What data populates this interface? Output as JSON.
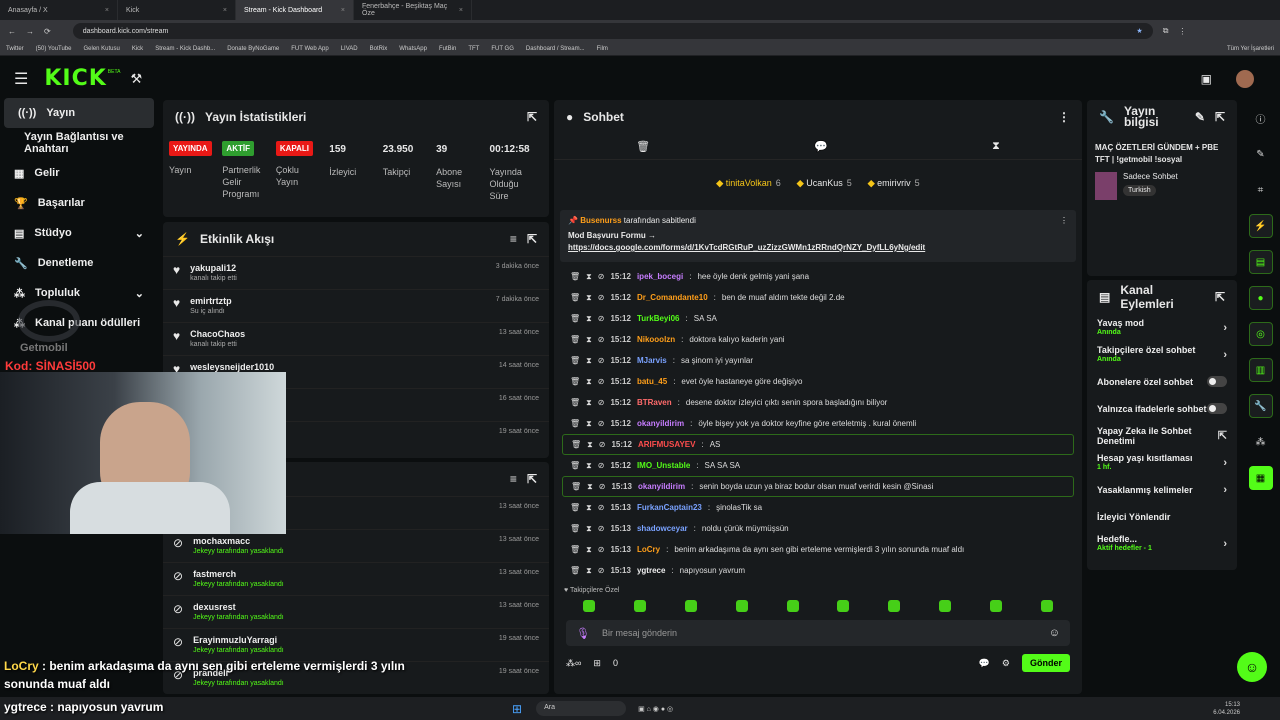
{
  "tabs": [
    "Anasayfa / X",
    "Kick",
    "Stream - Kick Dashboard",
    "Fenerbahçe - Beşiktaş Maç Öze"
  ],
  "url": "dashboard.kick.com/stream",
  "bookmarks": [
    "Twitter",
    "(50) YouTube",
    "Gelen Kutusu",
    "Kick",
    "Stream - Kick Dashb...",
    "Donate ByNoGame",
    "FUT Web App",
    "LIVAD",
    "BotRix",
    "WhatsApp",
    "FutBin",
    "TFT",
    "FUT GG",
    "Dashboard / Stream...",
    "Film"
  ],
  "bookmarks_right": "Tüm Yer İşaretleri",
  "logo": "KICK",
  "logo_beta": "BETA",
  "sidebar": [
    "Yayın",
    "Yayın Bağlantısı ve Anahtarı",
    "Gelir",
    "Başarılar",
    "Stüdyo",
    "Denetleme",
    "Topluluk",
    "Kanal puanı ödülleri"
  ],
  "stats": {
    "title": "Yayın İstatistikleri",
    "items": [
      {
        "badge": "YAYINDA",
        "color": "#e91916",
        "label": "Yayın"
      },
      {
        "badge": "AKTİF",
        "color": "#2f9e2f",
        "label": "Partnerlik Gelir Programı"
      },
      {
        "badge": "KAPALI",
        "color": "#e91916",
        "label": "Çoklu Yayın"
      },
      {
        "value": "159",
        "label": "İzleyici"
      },
      {
        "value": "23.950",
        "label": "Takipçi"
      },
      {
        "value": "39",
        "label": "Abone Sayısı"
      },
      {
        "value": "00:12:58",
        "label": "Yayında Olduğu Süre"
      }
    ]
  },
  "activity": {
    "title": "Etkinlik Akışı",
    "rows": [
      {
        "name": "yakupali12",
        "sub": "kanalı takip etti",
        "time": "3 dakika önce"
      },
      {
        "name": "emirtrtztp",
        "sub": "Su iç alındı",
        "time": "7 dakika önce"
      },
      {
        "name": "ChacoChaos",
        "sub": "kanalı takip etti",
        "time": "13 saat önce"
      },
      {
        "name": "wesleysneijder1010",
        "sub": "",
        "time": "14 saat önce"
      },
      {
        "name": "",
        "sub": "",
        "time": "16 saat önce"
      },
      {
        "name": "",
        "sub": "",
        "time": "19 saat önce"
      }
    ]
  },
  "mod": {
    "title": "Yasaklı Kullanıcılar",
    "rows": [
      {
        "name": "",
        "sub": "",
        "time": "13 saat önce"
      },
      {
        "name": "mochaxmacc",
        "sub": "Jekeyy tarafından yasaklandı",
        "time": "13 saat önce"
      },
      {
        "name": "fastmerch",
        "sub": "Jekeyy tarafından yasaklandı",
        "time": "13 saat önce"
      },
      {
        "name": "dexusrest",
        "sub": "Jekeyy tarafından yasaklandı",
        "time": "13 saat önce"
      },
      {
        "name": "ErayinmuzluYarragi",
        "sub": "Jekeyy tarafından yasaklandı",
        "time": "19 saat önce"
      },
      {
        "name": "prandeli",
        "sub": "Jekeyy tarafından yasaklandı",
        "time": "19 saat önce"
      }
    ]
  },
  "chat": {
    "title": "Sohbet",
    "top": [
      {
        "rank": "1",
        "name": "tinitaVolkan",
        "n": "6"
      },
      {
        "name": "UcanKus",
        "n": "5"
      },
      {
        "name": "emirivriv",
        "n": "5"
      }
    ],
    "pin_by": "Busenurss",
    "pin_text": "tarafından sabitlendi",
    "pin_title": "Mod Başvuru Formu →",
    "pin_link": "https://docs.google.com/forms/d/1KvTcdRGtRuP_uzZizzGWMn1zRRndQrNZY_DyfLL6yNg/edit",
    "messages": [
      {
        "t": "15:12",
        "u": "ipek_bocegi",
        "c": "#c77dff",
        "m": "hee öyle denk gelmiş yani şana"
      },
      {
        "t": "15:12",
        "u": "Dr_Comandante10",
        "c": "#ff9f1a",
        "m": "ben de muaf aldım tekte değil 2.de"
      },
      {
        "t": "15:12",
        "u": "TurkBeyi06",
        "c": "#53fc18",
        "m": "SA SA"
      },
      {
        "t": "15:12",
        "u": "Nikooolzn",
        "c": "#ff9f1a",
        "m": "doktora kalıyo kaderin yani"
      },
      {
        "t": "15:12",
        "u": "MJarvis",
        "c": "#7aa2ff",
        "m": "sa şinom iyi yayınlar"
      },
      {
        "t": "15:12",
        "u": "batu_45",
        "c": "#ff9f1a",
        "m": "evet öyle hastaneye göre değişiyo"
      },
      {
        "t": "15:12",
        "u": "BTRaven",
        "c": "#ff6b6b",
        "m": "desene doktor izleyici çıktı senin spora başladığını biliyor"
      },
      {
        "t": "15:12",
        "u": "okanyildirim",
        "c": "#c77dff",
        "m": "öyle bişey yok ya doktor keyfine göre erteletmiş . kural önemli"
      },
      {
        "t": "15:12",
        "u": "ARIFMUSAYEV",
        "c": "#ff4d4d",
        "m": "AS"
      },
      {
        "t": "15:12",
        "u": "IMO_Unstable",
        "c": "#53fc18",
        "m": "SA SA SA"
      },
      {
        "t": "15:13",
        "u": "okanyildirim",
        "c": "#c77dff",
        "m": "senin boyda uzun ya biraz bodur olsan muaf verirdi kesin @Sinasi"
      },
      {
        "t": "15:13",
        "u": "FurkanCaptain23",
        "c": "#7aa2ff",
        "m": "şinolasTik sa"
      },
      {
        "t": "15:13",
        "u": "shadowceyar",
        "c": "#7aa2ff",
        "m": "noldu çürük müymüşsün"
      },
      {
        "t": "15:13",
        "u": "LoCry",
        "c": "#ff9f1a",
        "m": "benim arkadaşıma da aynı sen gibi erteleme vermişlerdi 3 yılın sonunda muaf aldı"
      },
      {
        "t": "15:13",
        "u": "ygtrece",
        "c": "#eeeeee",
        "m": "napıyosun yavrum"
      }
    ],
    "followers_only": "Takipçilere Özel",
    "placeholder": "Bir mesaj gönderin",
    "count": "0",
    "send": "Gönder"
  },
  "info": {
    "title": "Yayın bilgisi",
    "stream_title": "MAÇ ÖZETLERİ GÜNDEM + PBE TFT | !getmobil !sosyal",
    "category": "Sadece Sohbet",
    "tag": "Turkish"
  },
  "actions": {
    "title": "Kanal Eylemleri",
    "items": [
      {
        "label": "Yavaş mod",
        "sub": "Anında",
        "kind": "arrow"
      },
      {
        "label": "Takipçilere özel sohbet",
        "sub": "Anında",
        "kind": "arrow"
      },
      {
        "label": "Abonelere özel sohbet",
        "sub": "",
        "kind": "toggle"
      },
      {
        "label": "Yalnızca ifadelerle sohbet",
        "sub": "",
        "kind": "toggle"
      },
      {
        "label": "Yapay Zeka ile Sohbet Denetimi",
        "sub": "",
        "kind": "ext"
      },
      {
        "label": "Hesap yaşı kısıtlaması",
        "sub": "1 hf.",
        "kind": "arrow"
      },
      {
        "label": "Yasaklanmış kelimeler",
        "sub": "",
        "kind": "arrow"
      },
      {
        "label": "İzleyici Yönlendir",
        "sub": "",
        "kind": "none"
      },
      {
        "label": "Hedefle...",
        "sub": "Aktif hedefler - 1",
        "kind": "arrow"
      }
    ]
  },
  "overlay": {
    "watermark": "Getmobil",
    "code": "Kod: SİNASİ500",
    "line1_user": "LoCry",
    "line1": "benim arkadaşıma da aynı sen gibi erteleme vermişlerdi 3 yılın sonunda muaf aldı",
    "line2_user": "ygtrece",
    "line2": "napıyosun yavrum"
  },
  "taskbar": {
    "search": "Ara",
    "time": "15:13",
    "date": "6.04.2026"
  }
}
